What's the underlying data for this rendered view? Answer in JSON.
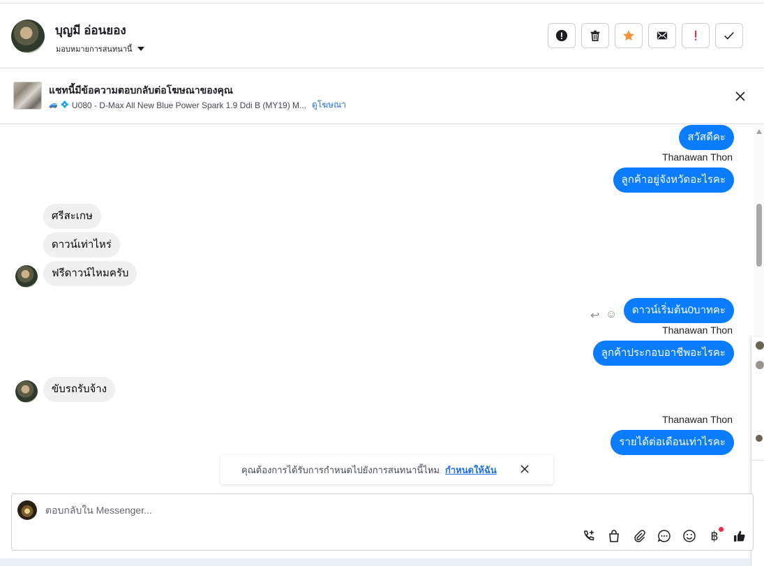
{
  "header": {
    "contact_name": "บุญมี อ่อนยอง",
    "assign_label": "มอบหมายการสนทนานี้",
    "toolbar": [
      {
        "name": "spam-report-button",
        "icon": "alert-circle-icon"
      },
      {
        "name": "delete-button",
        "icon": "trash-icon"
      },
      {
        "name": "star-button",
        "icon": "star-icon"
      },
      {
        "name": "mark-unread-button",
        "icon": "envelope-icon"
      },
      {
        "name": "follow-up-button",
        "icon": "exclamation-icon"
      },
      {
        "name": "mark-done-button",
        "icon": "checkmark-icon"
      }
    ]
  },
  "banner": {
    "title": "แชทนี้มีข้อความตอบกลับต่อโฆษณาของคุณ",
    "ad_text": "U080 - D-Max All New Blue Power Spark 1.9 Ddi B (MY19) M...",
    "link": "ดูโฆษณา"
  },
  "messages": [
    {
      "dir": "out",
      "text": "สวัสดีคะ"
    },
    {
      "dir": "sender",
      "text": "Thanawan Thon"
    },
    {
      "dir": "out",
      "text": "ลูกค้าอยู่จังหวัดอะไรคะ"
    },
    {
      "dir": "in",
      "text": "ศรีสะเกษ"
    },
    {
      "dir": "in",
      "text": "ดาวน์เท่าไหร่"
    },
    {
      "dir": "in",
      "text": "ฟรีดาวน์ไหมครับ"
    },
    {
      "dir": "out",
      "text": "ดาวน์เริ่มต้น0บาทคะ"
    },
    {
      "dir": "sender",
      "text": "Thanawan Thon"
    },
    {
      "dir": "out",
      "text": "ลูกค้าประกอบอาชีพอะไรคะ"
    },
    {
      "dir": "in",
      "text": "ขับรถรับจ้าง"
    },
    {
      "dir": "sender",
      "text": "Thanawan Thon"
    },
    {
      "dir": "out",
      "text": "รายได้ต่อเดือนเท่าไรคะ"
    }
  ],
  "notice": {
    "text": "คุณต้องการได้รับการกำหนดไปยังการสนทนานี้ไหม",
    "link": "กำหนดให้ฉัน"
  },
  "composer": {
    "placeholder": "ตอบกลับใน Messenger...",
    "baht_symbol": "฿",
    "tools": [
      "phone-add-icon",
      "shopping-bag-icon",
      "paperclip-icon",
      "saved-reply-icon",
      "emoji-icon",
      "baht-icon",
      "thumbs-up-icon"
    ]
  },
  "colors": {
    "outgoing_bubble": "#0a7cff",
    "incoming_bubble": "#f0f0f0",
    "link": "#216fdb",
    "star": "#f7923b",
    "alert_red": "#e41e3f"
  }
}
